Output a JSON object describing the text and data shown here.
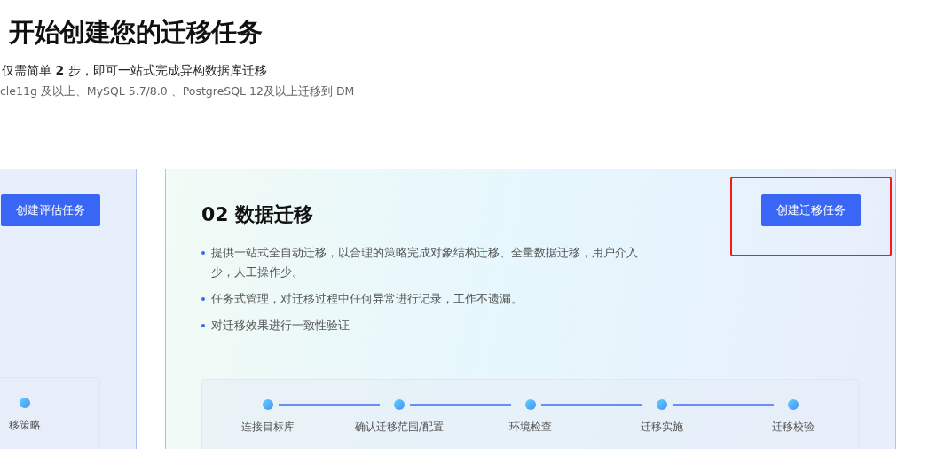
{
  "header": {
    "title": "开始创建您的迁移任务",
    "subtitle": "仅需简单 **2** 步，即可一站式完成异构数据库迁移",
    "note": "cle11g 及以上、MySQL 5.7/8.0 、PostgreSQL 12及以上迁移到 DM"
  },
  "cards": [
    {
      "button": "创建评估任务",
      "highlighted": false,
      "steps": [
        {
          "label": "移策略"
        }
      ]
    },
    {
      "title": "02 数据迁移",
      "button": "创建迁移任务",
      "highlighted": true,
      "bullets": [
        "提供一站式全自动迁移，以合理的策略完成对象结构迁移、全量数据迁移，用户介入少，人工操作少。",
        "任务式管理，对迁移过程中任何异常进行记录，工作不遗漏。",
        "对迁移效果进行一致性验证"
      ],
      "steps": [
        {
          "label": "连接目标库"
        },
        {
          "label": "确认迁移范围/配置"
        },
        {
          "label": "环境检查"
        },
        {
          "label": "迁移实施"
        },
        {
          "label": "迁移校验"
        }
      ]
    }
  ]
}
